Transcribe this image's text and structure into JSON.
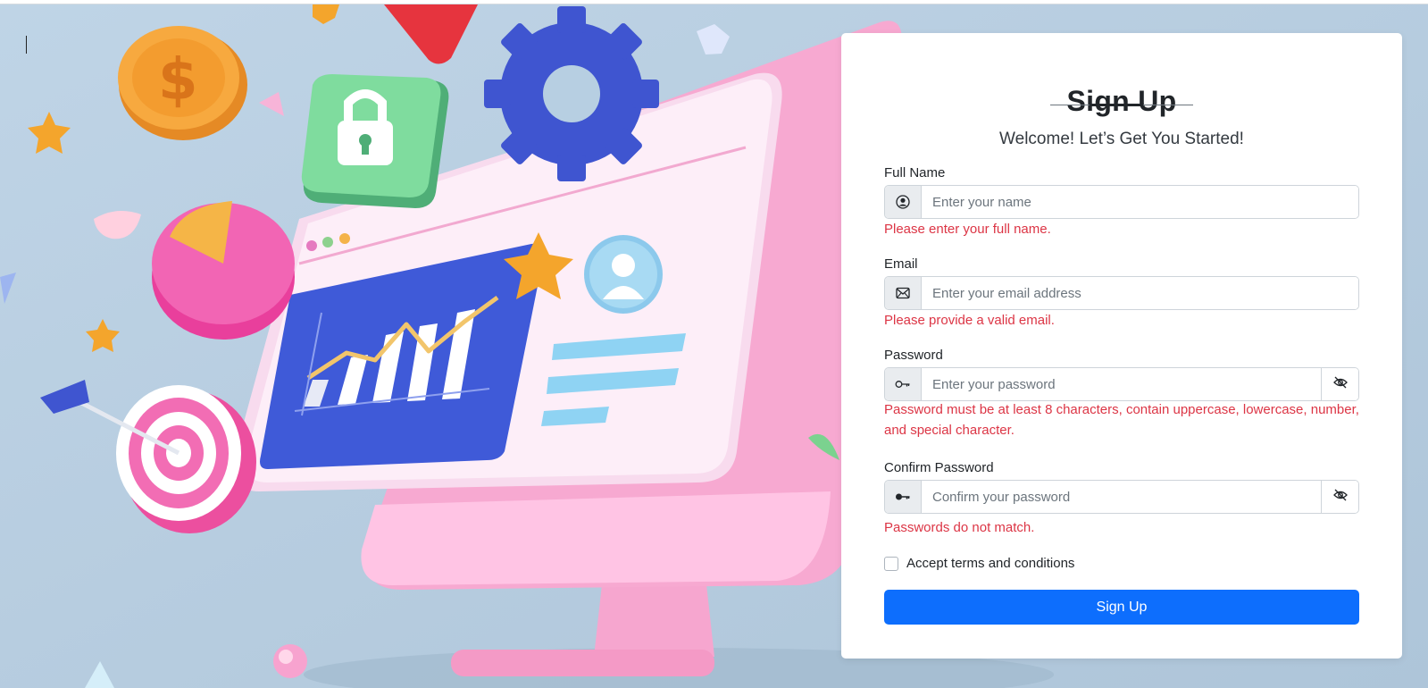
{
  "form": {
    "title": "Sign Up",
    "subtitle": "Welcome! Let’s Get You Started!",
    "full_name": {
      "label": "Full Name",
      "placeholder": "Enter your name",
      "value": "",
      "error": "Please enter your full name.",
      "icon": "user-circle-icon"
    },
    "email": {
      "label": "Email",
      "placeholder": "Enter your email address",
      "value": "",
      "error": "Please provide a valid email.",
      "icon": "envelope-icon"
    },
    "password": {
      "label": "Password",
      "placeholder": "Enter your password",
      "value": "",
      "error": "Password must be at least 8 characters, contain uppercase, lowercase, number, and special character.",
      "icon": "key-outline-icon",
      "toggle_icon": "eye-slash-icon"
    },
    "confirm_password": {
      "label": "Confirm Password",
      "placeholder": "Confirm your password",
      "value": "",
      "error": "Passwords do not match.",
      "icon": "key-filled-icon",
      "toggle_icon": "eye-slash-icon"
    },
    "terms": {
      "label": "Accept terms and conditions",
      "checked": false
    },
    "submit_label": "Sign Up"
  },
  "colors": {
    "primary": "#0d6efd",
    "error": "#dc3545",
    "background": "#b7cfe2"
  }
}
